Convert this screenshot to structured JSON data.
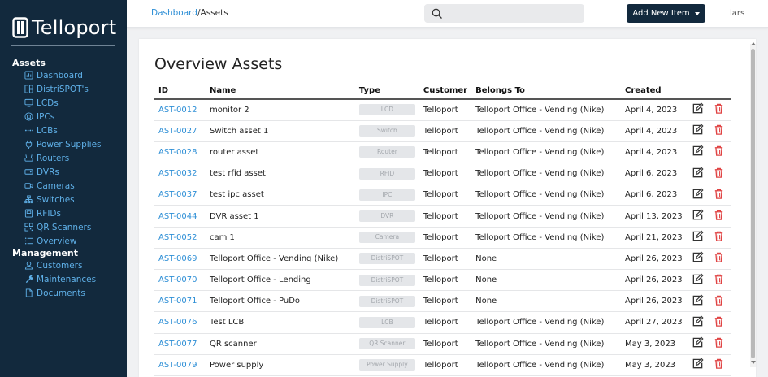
{
  "brand": {
    "name": "Telloport"
  },
  "sidebar": {
    "assets_header": "Assets",
    "assets_items": [
      {
        "label": "Dashboard",
        "icon": "dashboard-icon"
      },
      {
        "label": "DistriSPOT's",
        "icon": "grid-icon"
      },
      {
        "label": "LCDs",
        "icon": "monitor-icon"
      },
      {
        "label": "IPCs",
        "icon": "cpu-icon"
      },
      {
        "label": "LCBs",
        "icon": "dots-icon"
      },
      {
        "label": "Power Supplies",
        "icon": "plug-icon"
      },
      {
        "label": "Routers",
        "icon": "router-icon"
      },
      {
        "label": "DVRs",
        "icon": "dvr-icon"
      },
      {
        "label": "Cameras",
        "icon": "camera-icon"
      },
      {
        "label": "Switches",
        "icon": "switch-icon"
      },
      {
        "label": "RFIDs",
        "icon": "rfid-icon"
      },
      {
        "label": "QR Scanners",
        "icon": "qr-icon"
      },
      {
        "label": "Overview",
        "icon": "list-icon"
      }
    ],
    "management_header": "Management",
    "management_items": [
      {
        "label": "Customers",
        "icon": "user-icon"
      },
      {
        "label": "Maintenances",
        "icon": "wrench-icon"
      },
      {
        "label": "Documents",
        "icon": "document-icon"
      }
    ]
  },
  "topbar": {
    "breadcrumb_link": "Dashboard",
    "breadcrumb_current": "/Assets",
    "search_placeholder": "",
    "add_button": "Add New Item",
    "user": "lars"
  },
  "page": {
    "title": "Overview Assets"
  },
  "table": {
    "columns": [
      "ID",
      "Name",
      "Type",
      "Customer",
      "Belongs To",
      "Created"
    ],
    "rows": [
      {
        "id": "AST-0012",
        "name": "monitor 2",
        "type": "LCD",
        "customer": "Telloport",
        "belongs": "Telloport Office - Vending (Nike)",
        "created": "April 4, 2023"
      },
      {
        "id": "AST-0027",
        "name": "Switch asset 1",
        "type": "Switch",
        "customer": "Telloport",
        "belongs": "Telloport Office - Vending (Nike)",
        "created": "April 4, 2023"
      },
      {
        "id": "AST-0028",
        "name": "router asset",
        "type": "Router",
        "customer": "Telloport",
        "belongs": "Telloport Office - Vending (Nike)",
        "created": "April 4, 2023"
      },
      {
        "id": "AST-0032",
        "name": "test rfid asset",
        "type": "RFID",
        "customer": "Telloport",
        "belongs": "Telloport Office - Vending (Nike)",
        "created": "April 6, 2023"
      },
      {
        "id": "AST-0037",
        "name": "test ipc asset",
        "type": "IPC",
        "customer": "Telloport",
        "belongs": "Telloport Office - Vending (Nike)",
        "created": "April 6, 2023"
      },
      {
        "id": "AST-0044",
        "name": "DVR asset 1",
        "type": "DVR",
        "customer": "Telloport",
        "belongs": "Telloport Office - Vending (Nike)",
        "created": "April 13, 2023"
      },
      {
        "id": "AST-0052",
        "name": "cam 1",
        "type": "Camera",
        "customer": "Telloport",
        "belongs": "Telloport Office - Vending (Nike)",
        "created": "April 21, 2023"
      },
      {
        "id": "AST-0069",
        "name": "Telloport Office - Vending (Nike)",
        "type": "DistriSPOT",
        "customer": "Telloport",
        "belongs": "None",
        "created": "April 26, 2023"
      },
      {
        "id": "AST-0070",
        "name": "Telloport Office - Lending",
        "type": "DistriSPOT",
        "customer": "Telloport",
        "belongs": "None",
        "created": "April 26, 2023"
      },
      {
        "id": "AST-0071",
        "name": "Telloport Office - PuDo",
        "type": "DistriSPOT",
        "customer": "Telloport",
        "belongs": "None",
        "created": "April 26, 2023"
      },
      {
        "id": "AST-0076",
        "name": "Test LCB",
        "type": "LCB",
        "customer": "Telloport",
        "belongs": "Telloport Office - Vending (Nike)",
        "created": "April 27, 2023"
      },
      {
        "id": "AST-0077",
        "name": "QR scanner",
        "type": "QR Scanner",
        "customer": "Telloport",
        "belongs": "Telloport Office - Vending (Nike)",
        "created": "May 3, 2023"
      },
      {
        "id": "AST-0079",
        "name": "Power supply",
        "type": "Power Supply",
        "customer": "Telloport",
        "belongs": "Telloport Office - Vending (Nike)",
        "created": "May 3, 2023"
      }
    ]
  },
  "colors": {
    "sidebar_bg": "#12293d",
    "link": "#2e8fd6",
    "nav_link": "#5fb0e8",
    "delete": "#e04343"
  }
}
